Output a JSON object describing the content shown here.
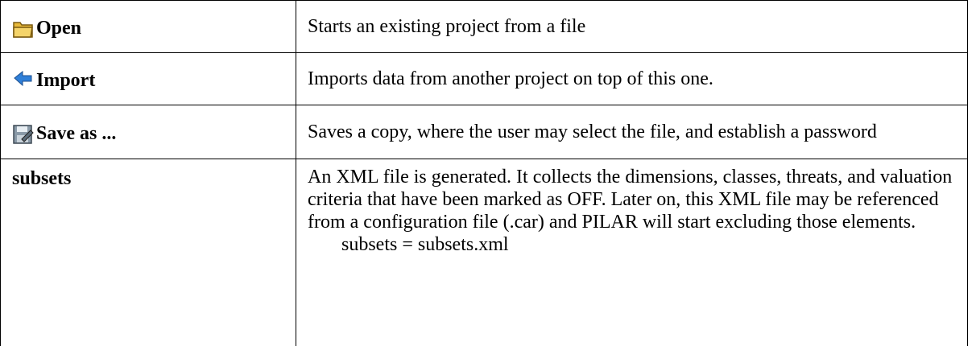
{
  "rows": [
    {
      "command": "Open",
      "icon": "folder-open-icon",
      "description": "Starts an existing project from a file"
    },
    {
      "command": "Import",
      "icon": "arrow-left-icon",
      "description": "Imports data from another project on top of this one."
    },
    {
      "command": "Save as ...",
      "icon": "save-as-icon",
      "description": "Saves a copy, where the user may select the file, and establish a password"
    },
    {
      "command": "subsets",
      "icon": "",
      "description": "An XML file is generated. It collects the dimensions, classes, threats, and valuation criteria that have been marked as OFF. Later on, this XML file may be referenced from a configuration file (.car) and PILAR will start excluding those elements.",
      "example": "subsets = subsets.xml"
    }
  ],
  "colors": {
    "folder": "#e8b93a",
    "arrow": "#2f7fd8",
    "border": "#000000"
  }
}
